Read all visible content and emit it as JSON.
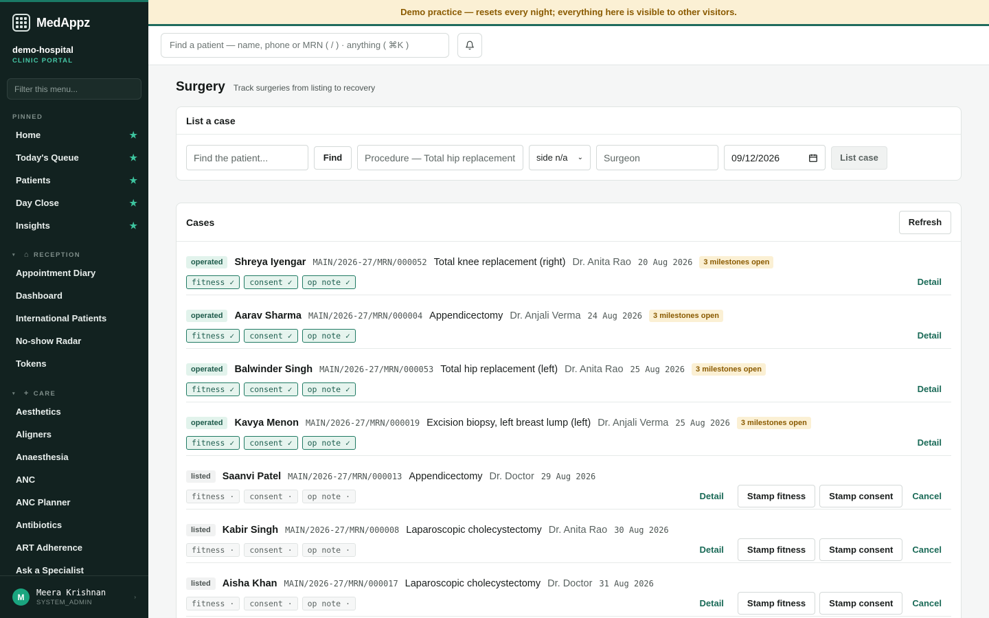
{
  "banner": "Demo practice — resets every night; everything here is visible to other visitors.",
  "brand": {
    "name": "MedAppz"
  },
  "org": {
    "name": "demo-hospital",
    "sub": "CLINIC PORTAL"
  },
  "sidebar": {
    "filter_placeholder": "Filter this menu...",
    "pinned_label": "PINNED",
    "pinned": [
      "Home",
      "Today's Queue",
      "Patients",
      "Day Close",
      "Insights"
    ],
    "reception_label": "RECEPTION",
    "reception": [
      "Appointment Diary",
      "Dashboard",
      "International Patients",
      "No-show Radar",
      "Tokens"
    ],
    "care_label": "CARE",
    "care": [
      "Aesthetics",
      "Aligners",
      "Anaesthesia",
      "ANC",
      "ANC Planner",
      "Antibiotics",
      "ART Adherence",
      "Ask a Specialist"
    ]
  },
  "user": {
    "initial": "M",
    "name": "Meera Krishnan",
    "role": "SYSTEM_ADMIN"
  },
  "topbar": {
    "search_placeholder": "Find a patient — name, phone or MRN ( / ) · anything ( ⌘K )"
  },
  "page": {
    "title": "Surgery",
    "subtitle": "Track surgeries from listing to recovery"
  },
  "list_case": {
    "title": "List a case",
    "patient_placeholder": "Find the patient...",
    "find_label": "Find",
    "procedure_placeholder": "Procedure — Total hip replacement",
    "side_value": "side n/a",
    "surgeon_placeholder": "Surgeon",
    "date_value": "09/12/2026",
    "submit_label": "List case"
  },
  "cases": {
    "title": "Cases",
    "refresh_label": "Refresh",
    "detail_label": "Detail",
    "stamp_fitness_label": "Stamp fitness",
    "stamp_consent_label": "Stamp consent",
    "cancel_label": "Cancel",
    "rows": [
      {
        "status": "operated",
        "name": "Shreya Iyengar",
        "mrn": "MAIN/2026-27/MRN/000052",
        "procedure": "Total knee replacement (right)",
        "surgeon": "Dr. Anita Rao",
        "date": "20 Aug 2026",
        "milestones": "3 milestones open",
        "chips": [
          "fitness ✓",
          "consent ✓",
          "op note ✓"
        ]
      },
      {
        "status": "operated",
        "name": "Aarav Sharma",
        "mrn": "MAIN/2026-27/MRN/000004",
        "procedure": "Appendicectomy",
        "surgeon": "Dr. Anjali Verma",
        "date": "24 Aug 2026",
        "milestones": "3 milestones open",
        "chips": [
          "fitness ✓",
          "consent ✓",
          "op note ✓"
        ]
      },
      {
        "status": "operated",
        "name": "Balwinder Singh",
        "mrn": "MAIN/2026-27/MRN/000053",
        "procedure": "Total hip replacement (left)",
        "surgeon": "Dr. Anita Rao",
        "date": "25 Aug 2026",
        "milestones": "3 milestones open",
        "chips": [
          "fitness ✓",
          "consent ✓",
          "op note ✓"
        ]
      },
      {
        "status": "operated",
        "name": "Kavya Menon",
        "mrn": "MAIN/2026-27/MRN/000019",
        "procedure": "Excision biopsy, left breast lump (left)",
        "surgeon": "Dr. Anjali Verma",
        "date": "25 Aug 2026",
        "milestones": "3 milestones open",
        "chips": [
          "fitness ✓",
          "consent ✓",
          "op note ✓"
        ]
      },
      {
        "status": "listed",
        "name": "Saanvi Patel",
        "mrn": "MAIN/2026-27/MRN/000013",
        "procedure": "Appendicectomy",
        "surgeon": "Dr. Doctor",
        "date": "29 Aug 2026",
        "milestones": "",
        "chips": [
          "fitness ·",
          "consent ·",
          "op note ·"
        ]
      },
      {
        "status": "listed",
        "name": "Kabir Singh",
        "mrn": "MAIN/2026-27/MRN/000008",
        "procedure": "Laparoscopic cholecystectomy",
        "surgeon": "Dr. Anita Rao",
        "date": "30 Aug 2026",
        "milestones": "",
        "chips": [
          "fitness ·",
          "consent ·",
          "op note ·"
        ]
      },
      {
        "status": "listed",
        "name": "Aisha Khan",
        "mrn": "MAIN/2026-27/MRN/000017",
        "procedure": "Laparoscopic cholecystectomy",
        "surgeon": "Dr. Doctor",
        "date": "31 Aug 2026",
        "milestones": "",
        "chips": [
          "fitness ·",
          "consent ·",
          "op note ·"
        ]
      }
    ]
  }
}
